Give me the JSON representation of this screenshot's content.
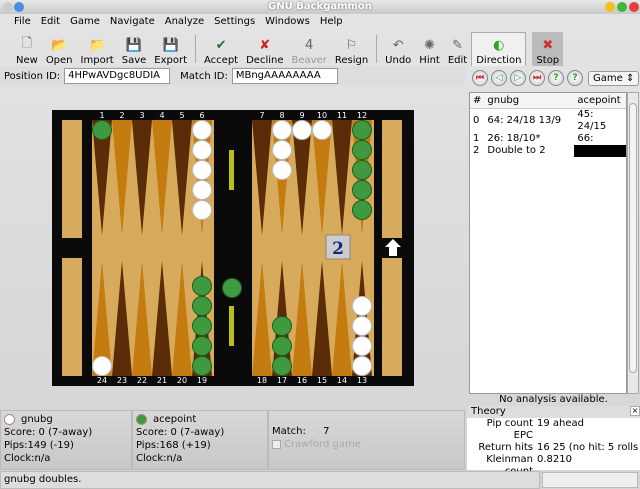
{
  "window": {
    "title": "GNU Backgammon"
  },
  "menu": [
    "File",
    "Edit",
    "Game",
    "Navigate",
    "Analyze",
    "Settings",
    "Windows",
    "Help"
  ],
  "toolbar": [
    {
      "label": "New",
      "icon": "new-file-icon",
      "glyph": "🗋"
    },
    {
      "label": "Open",
      "icon": "open-folder-icon",
      "glyph": "📂"
    },
    {
      "label": "Import",
      "icon": "import-icon",
      "glyph": "📁"
    },
    {
      "label": "Save",
      "icon": "save-icon",
      "glyph": "💾"
    },
    {
      "label": "Export",
      "icon": "export-icon",
      "glyph": "💾"
    },
    {
      "sep": true
    },
    {
      "label": "Accept",
      "icon": "check-icon",
      "glyph": "✔"
    },
    {
      "label": "Decline",
      "icon": "cross-icon",
      "glyph": "✘"
    },
    {
      "label": "Beaver",
      "icon": "beaver-icon",
      "glyph": "4",
      "disabled": true
    },
    {
      "label": "Resign",
      "icon": "flag-icon",
      "glyph": "⚐"
    },
    {
      "sep": true
    },
    {
      "label": "Undo",
      "icon": "undo-icon",
      "glyph": "↶"
    },
    {
      "label": "Hint",
      "icon": "hint-icon",
      "glyph": "✺"
    },
    {
      "label": "Edit",
      "icon": "edit-icon",
      "glyph": "✎"
    },
    {
      "label": "Direction",
      "icon": "direction-icon",
      "glyph": "◐",
      "active": true
    },
    {
      "label": "Stop",
      "icon": "stop-icon",
      "glyph": "✖",
      "stop": true
    }
  ],
  "ids": {
    "position_label": "Position ID:",
    "position_value": "4HPwAVDgc8UDIA",
    "match_label": "Match ID:",
    "match_value": "MBngAAAAAAAA"
  },
  "nav": {
    "game_select": "Game"
  },
  "board": {
    "top_numbers": [
      "1",
      "2",
      "3",
      "4",
      "5",
      "6",
      "7",
      "8",
      "9",
      "10",
      "11",
      "12"
    ],
    "bottom_numbers": [
      "24",
      "23",
      "22",
      "21",
      "20",
      "19",
      "18",
      "17",
      "16",
      "15",
      "14",
      "13"
    ],
    "checkers": [
      {
        "point": 1,
        "color": "green",
        "count": 1
      },
      {
        "point": 6,
        "color": "white",
        "count": 5
      },
      {
        "point": 8,
        "color": "white",
        "count": 3
      },
      {
        "point": 9,
        "color": "white",
        "count": 1
      },
      {
        "point": 10,
        "color": "white",
        "count": 1
      },
      {
        "point": 12,
        "color": "green",
        "count": 5
      },
      {
        "point": 24,
        "color": "white",
        "count": 1
      },
      {
        "point": 19,
        "color": "green",
        "count": 5
      },
      {
        "point": 17,
        "color": "green",
        "count": 3
      },
      {
        "point": 13,
        "color": "white",
        "count": 4
      }
    ],
    "bar": {
      "green": 1
    },
    "cube": "2",
    "colors": {
      "frame": "#0a0a0a",
      "felt": "#d8aa5c",
      "dark": "#5a2c08",
      "light": "#c47c10",
      "green": "#3f9a3f",
      "white": "#ffffff"
    }
  },
  "movelist": {
    "headers": [
      "#",
      "gnubg",
      "acepoint"
    ],
    "rows": [
      [
        "0",
        "64: 24/18 13/9",
        "45: 24/15"
      ],
      [
        "1",
        "26: 18/10*",
        "66:"
      ],
      [
        "2",
        "Double to 2",
        ""
      ]
    ]
  },
  "analysis": {
    "none": "No analysis available."
  },
  "theory": {
    "title": "Theory",
    "rows": [
      [
        "Pip count",
        "19 ahead"
      ],
      [
        "EPC",
        ""
      ],
      [
        "Return hits",
        "16 25 (no hit: 5 rolls"
      ],
      [
        "Kleinman count",
        "0.8210"
      ]
    ]
  },
  "players": [
    {
      "name": "gnubg",
      "score": "Score:  0 (7-away)",
      "pips": "Pips:149 (-19)",
      "clock": "Clock:n/a",
      "color": "#ffffff"
    },
    {
      "name": "acepoint",
      "score": "Score:  0 (7-away)",
      "pips": "Pips:168 (+19)",
      "clock": "Clock:n/a",
      "color": "#3f9a3f"
    }
  ],
  "match": {
    "label": "Match:",
    "value": "7",
    "crawford": "Crawford game"
  },
  "status": "gnubg doubles."
}
